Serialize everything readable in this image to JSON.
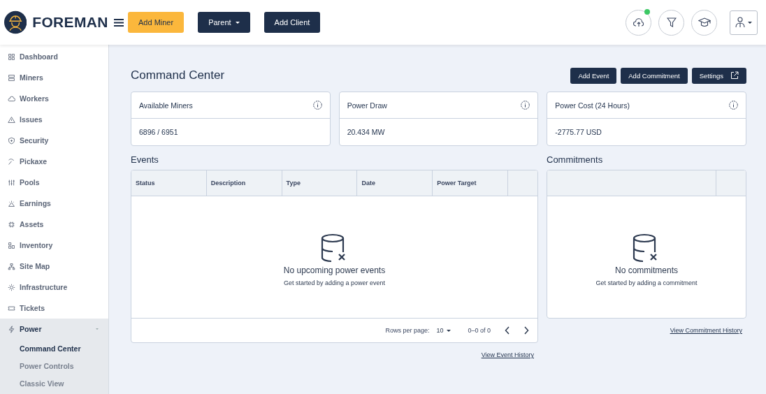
{
  "header": {
    "logo": "FOREMAN",
    "buttons": [
      {
        "label": "Add Miner",
        "kind": "primary"
      },
      {
        "label": "Parent",
        "kind": "dropdown"
      },
      {
        "label": "Add Client",
        "kind": "dark"
      }
    ],
    "icon_buttons": [
      {
        "notification": true
      },
      {
        "notification": false
      },
      {
        "notification": false
      }
    ]
  },
  "sidebar": {
    "items": [
      {
        "label": "Dashboard"
      },
      {
        "label": "Miners"
      },
      {
        "label": "Workers"
      },
      {
        "label": "Issues"
      },
      {
        "label": "Security"
      },
      {
        "label": "Pickaxe"
      },
      {
        "label": "Pools"
      },
      {
        "label": "Earnings"
      },
      {
        "label": "Assets"
      },
      {
        "label": "Inventory"
      },
      {
        "label": "Site Map"
      },
      {
        "label": "Infrastructure"
      },
      {
        "label": "Tickets"
      },
      {
        "label": "Power",
        "expanded": true,
        "children": [
          {
            "label": "Command Center",
            "selected": true
          },
          {
            "label": "Power Controls",
            "selected": false
          },
          {
            "label": "Classic View",
            "selected": false
          }
        ]
      }
    ]
  },
  "page": {
    "title": "Command Center",
    "actions": [
      {
        "label": "Add Event",
        "external": false
      },
      {
        "label": "Add Commitment",
        "external": false
      },
      {
        "label": "Settings",
        "external": true
      }
    ],
    "stats": [
      {
        "label": "Available Miners",
        "value": "6896 / 6951"
      },
      {
        "label": "Power Draw",
        "value": "20.434 MW"
      },
      {
        "label": "Power Cost (24 Hours)",
        "value": "-2775.77 USD"
      }
    ],
    "events": {
      "title": "Events",
      "columns": [
        "Status",
        "Description",
        "Type",
        "Date",
        "Power Target"
      ],
      "empty_title": "No upcoming power events",
      "empty_text": "Get started by adding a power event",
      "rows_per_page_label": "Rows per page:",
      "rows_per_page": "10",
      "range": "0–0 of 0",
      "history_link": "View Event History"
    },
    "commitments": {
      "title": "Commitments",
      "empty_title": "No commitments",
      "empty_text": "Get started by adding a commitment",
      "history_link": "View Commitment History"
    }
  }
}
